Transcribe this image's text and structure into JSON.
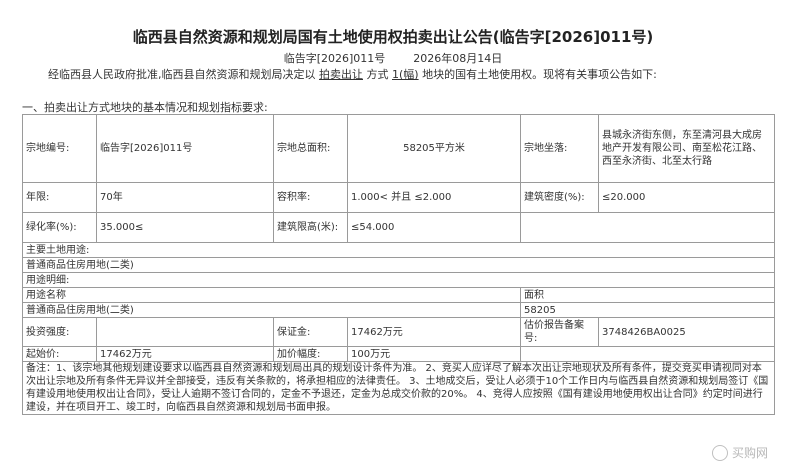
{
  "header": {
    "title": "临西县自然资源和规划局国有土地使用权拍卖出让公告(临告字[2026]011号)",
    "doc_no": "临告字[2026]011号",
    "date": "2026年08月14日"
  },
  "intro": {
    "text_before": "经临西县人民政府批准,临西县自然资源和规划局决定以",
    "method": "拍卖出让",
    "text_mid": "方式",
    "count": "1(幅)",
    "text_after": "地块的国有土地使用权。现将有关事项公告如下:"
  },
  "section_title": "一、拍卖出让方式地块的基本情况和规划指标要求:",
  "table": {
    "parcel_no_label": "宗地编号:",
    "parcel_no_value": "临告字[2026]011号",
    "total_area_label": "宗地总面积:",
    "total_area_value": "58205平方米",
    "location_label": "宗地坐落:",
    "location_value": "县城永济街东侧，东至清河县大成房地产开发有限公司、南至松花江路、西至永济街、北至太行路",
    "term_label": "年限:",
    "term_value": "70年",
    "far_label": "容积率:",
    "far_value": "1.000< 并且 ≤2.000",
    "density_label": "建筑密度(%):",
    "density_value": "≤20.000",
    "green_label": "绿化率(%):",
    "green_value": "35.000≤",
    "height_label": "建筑限高(米):",
    "height_value": "≤54.000",
    "main_use_label": "主要土地用途:",
    "main_use_value": "普通商品住房用地(二类)",
    "use_desc_label": "用途明细:",
    "use_name_header": "用途名称",
    "area_header": "面积",
    "use_name_value": "普通商品住房用地(二类)",
    "use_area_value": "58205",
    "invest_label": "投资强度:",
    "invest_value": "",
    "deposit_label": "保证金:",
    "deposit_value": "17462万元",
    "report_label": "估价报告备案号:",
    "report_value": "3748426BA0025",
    "start_price_label": "起始价:",
    "start_price_value": "17462万元",
    "increment_label": "加价幅度:",
    "increment_value": "100万元",
    "notes": "备注：1、该宗地其他规划建设要求以临西县自然资源和规划局出具的规划设计条件为准。 2、竞买人应详尽了解本次出让宗地现状及所有条件，提交竞买申请视同对本次出让宗地及所有条件无异议并全部接受，违反有关条款的，将承担相应的法律责任。 3、土地成交后，受让人必须于10个工作日内与临西县自然资源和规划局签订《国有建设用地使用权出让合同》，受让人逾期不签订合同的，定金不予退还，定金为总成交价款的20%。 4、竞得人应按照《国有建设用地使用权出让合同》约定时间进行建设，并在项目开工、竣工时，向临西县自然资源和规划局书面申报。"
  },
  "watermark": "买购网"
}
